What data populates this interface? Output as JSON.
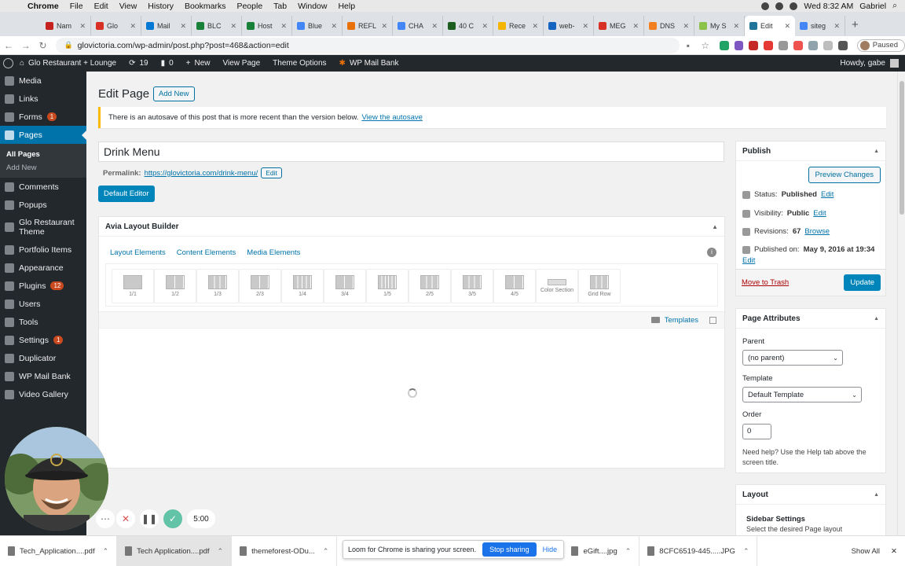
{
  "menubar": {
    "items": [
      "Chrome",
      "File",
      "Edit",
      "View",
      "History",
      "Bookmarks",
      "People",
      "Tab",
      "Window",
      "Help"
    ],
    "clock": "Wed 8:32 AM",
    "user": "Gabriel"
  },
  "browser": {
    "tabs": [
      {
        "label": "Nam",
        "color": "#c5221f"
      },
      {
        "label": "Glo",
        "color": "#d93025"
      },
      {
        "label": "Mail",
        "color": "#0078d4"
      },
      {
        "label": "BLC",
        "color": "#188038"
      },
      {
        "label": "Host",
        "color": "#188038"
      },
      {
        "label": "Blue",
        "color": "#4285f4"
      },
      {
        "label": "REFL",
        "color": "#e8710a"
      },
      {
        "label": "CHA",
        "color": "#4285f4"
      },
      {
        "label": "40 C",
        "color": "#1b5e20"
      },
      {
        "label": "Rece",
        "color": "#f4b400"
      },
      {
        "label": "web-",
        "color": "#1565c0"
      },
      {
        "label": "MEG",
        "color": "#d93025"
      },
      {
        "label": "DNS",
        "color": "#f38020"
      },
      {
        "label": "My S",
        "color": "#8bc34a"
      },
      {
        "label": "Edit",
        "color": "#21759b",
        "active": true
      },
      {
        "label": "siteg",
        "color": "#4285f4"
      }
    ],
    "url": "glovictoria.com/wp-admin/post.php?post=468&action=edit",
    "paused_label": "Paused"
  },
  "adminbar": {
    "site": "Glo Restaurant + Lounge",
    "updates": "19",
    "comments": "0",
    "new": "New",
    "view_page": "View Page",
    "theme_options": "Theme Options",
    "wp_mail_bank": "WP Mail Bank",
    "howdy": "Howdy, gabe"
  },
  "sidebar": {
    "items": [
      {
        "label": "Media"
      },
      {
        "label": "Links"
      },
      {
        "label": "Forms",
        "badge": "1"
      },
      {
        "label": "Pages",
        "current": true
      },
      {
        "label": "Comments"
      },
      {
        "label": "Popups"
      },
      {
        "label": "Glo Restaurant Theme",
        "two_line": true
      },
      {
        "label": "Portfolio Items"
      },
      {
        "label": "Appearance"
      },
      {
        "label": "Plugins",
        "badge": "12"
      },
      {
        "label": "Users"
      },
      {
        "label": "Tools"
      },
      {
        "label": "Settings",
        "badge": "1"
      },
      {
        "label": "Duplicator"
      },
      {
        "label": "WP Mail Bank"
      },
      {
        "label": "Video Gallery"
      }
    ],
    "submenu": [
      "All Pages",
      "Add New"
    ]
  },
  "page": {
    "heading": "Edit Page",
    "add_new": "Add New",
    "notice_text": "There is an autosave of this post that is more recent than the version below.",
    "notice_link": "View the autosave",
    "title_value": "Drink Menu",
    "permalink_label": "Permalink:",
    "permalink_url": "https://glovictoria.com/drink-menu/",
    "permalink_edit": "Edit",
    "default_editor": "Default Editor"
  },
  "avia": {
    "title": "Avia Layout Builder",
    "tabs": [
      "Layout Elements",
      "Content Elements",
      "Media Elements"
    ],
    "elements": [
      "1/1",
      "1/2",
      "1/3",
      "2/3",
      "1/4",
      "3/4",
      "1/5",
      "2/5",
      "3/5",
      "4/5",
      "Color Section",
      "Grid Row"
    ],
    "templates": "Templates"
  },
  "publish": {
    "title": "Publish",
    "preview": "Preview Changes",
    "status_label": "Status:",
    "status_value": "Published",
    "visibility_label": "Visibility:",
    "visibility_value": "Public",
    "revisions_label": "Revisions:",
    "revisions_value": "67",
    "browse": "Browse",
    "published_label": "Published on:",
    "published_value": "May 9, 2016 at 19:34",
    "edit": "Edit",
    "trash": "Move to Trash",
    "update": "Update"
  },
  "attributes": {
    "title": "Page Attributes",
    "parent_label": "Parent",
    "parent_value": "(no parent)",
    "template_label": "Template",
    "template_value": "Default Template",
    "order_label": "Order",
    "order_value": "0",
    "help": "Need help? Use the Help tab above the screen title."
  },
  "layout_box": {
    "title": "Layout",
    "sidebar_settings": "Sidebar Settings",
    "sidebar_desc": "Select the desired Page layout"
  },
  "loom": {
    "timer": "5:00",
    "share_text": "Loom for Chrome is sharing your screen.",
    "stop": "Stop sharing",
    "hide": "Hide"
  },
  "downloads": {
    "items": [
      "Tech_Application....pdf",
      "Tech Application....pdf",
      "themeforest-ODu...",
      "eGift....jpg",
      "8CFC6519-445.....JPG"
    ],
    "show_all": "Show All"
  }
}
